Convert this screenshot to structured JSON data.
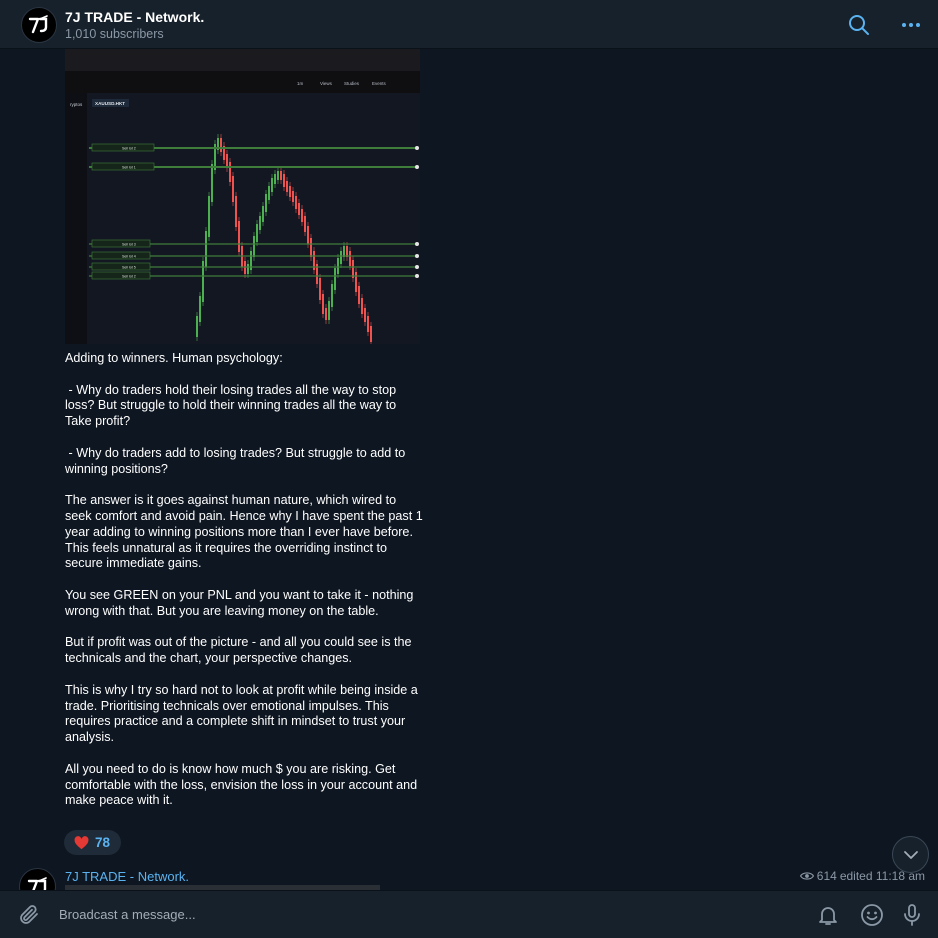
{
  "channel": {
    "name": "7J TRADE - Network.",
    "subscribers": "1,010 subscribers",
    "avatar_text": "7J"
  },
  "message": {
    "chart_image": {
      "symbol": "XAUUSD.HKT",
      "toolbar_items": [
        "1m",
        "Views",
        "Studies",
        "Events"
      ],
      "side_label": "ryptos",
      "levels": [
        "Sell lot 2",
        "Sell lot 1",
        "Sell lot 3",
        "Sell lot 4",
        "Sell lot 5",
        "Sell lot 2"
      ]
    },
    "text": "Adding to winners. Human psychology:\n\n - Why do traders hold their losing trades all the way to stop loss? But struggle to hold their winning trades all the way to Take profit?\n\n - Why do traders add to losing trades? But struggle to add to winning positions?\n\nThe answer is it goes against human nature, which wired to seek comfort and avoid pain. Hence why I have spent the past 1 year adding to winning positions more than I ever have before. This feels unnatural as it requires the overriding instinct to secure immediate gains.\n\nYou see GREEN on your PNL and you want to take it - nothing wrong with that. But you are leaving money on the table.\n\nBut if profit was out of the picture - and all you could see is the technicals and the chart, your perspective changes.\n\nThis is why I try so hard not to look at profit while being inside a trade. Prioritising technicals over emotional impulses. This requires practice and a complete shift in mindset to trust your analysis.\n\nAll you need to do is know how much $ you are risking. Get comfortable with the loss, envision the loss in your account and make peace with it.",
    "reaction": {
      "emoji": "heart",
      "count": "78"
    }
  },
  "next_message": {
    "sender": "7J TRADE - Network.",
    "views": "614",
    "edited_time": "edited 11:18 am"
  },
  "input": {
    "placeholder": "Broadcast a message..."
  },
  "icons": {
    "search": "search-icon",
    "more": "more-icon",
    "attach": "paperclip-icon",
    "bell": "bell-icon",
    "emoji": "emoji-icon",
    "mic": "microphone-icon",
    "scroll_down": "chevron-down-icon",
    "views": "eye-icon"
  },
  "colors": {
    "background": "#0e1621",
    "header": "#17212b",
    "accent": "#5ab3f0",
    "heart": "#e53935",
    "candle_up": "#4caf50",
    "candle_down": "#ef5350"
  }
}
